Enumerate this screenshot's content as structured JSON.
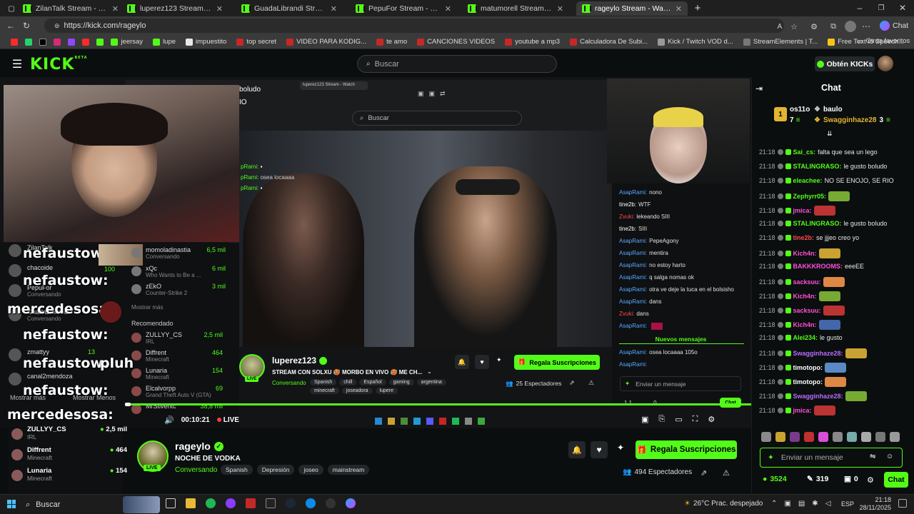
{
  "browser": {
    "tabs": [
      {
        "title": "ZilanTalk Stream - Watch Live"
      },
      {
        "title": "luperez123 Stream - Watch Live"
      },
      {
        "title": "GuadaLibrandi Stream - Watch Live"
      },
      {
        "title": "PepuFor Stream - Watch Live"
      },
      {
        "title": "matumorell Stream - Watch Live"
      },
      {
        "title": "rageylo Stream - Watch Live",
        "active": true
      }
    ],
    "url": "https://kick.com/rageylo",
    "profile_label": "Chat",
    "bookmarks": [
      {
        "label": "jeersay"
      },
      {
        "label": "lupe"
      },
      {
        "label": "impuestito"
      },
      {
        "label": "top secret"
      },
      {
        "label": "VIDEO PARA KODIG..."
      },
      {
        "label": "te amo"
      },
      {
        "label": "CANCIONES VIDEOS"
      },
      {
        "label": "youtube a mp3"
      },
      {
        "label": "Calculadora De Subi..."
      },
      {
        "label": "Kick / Twitch VOD d..."
      },
      {
        "label": "StreamElements | T..."
      },
      {
        "label": "Free Text to Speech..."
      }
    ],
    "other_bookmarks": "Otros favoritos"
  },
  "header": {
    "logo": "KICK",
    "logo_sup": "BETA",
    "search_placeholder": "Buscar",
    "get_kicks": "Obtén KICKs"
  },
  "inner_capture": {
    "search_placeholder": "Buscar",
    "tab_title": "luperez123 Stream - Watch",
    "partial_text_1": "boludo",
    "partial_text_2": "IO",
    "partial_text_3": "oludo",
    "chat_lines": [
      {
        "user": "AsapRami:",
        "text": "nono"
      },
      {
        "user": "tine2b:",
        "text": "WTF"
      },
      {
        "user": "Zvuki:",
        "text": "lekeando SIII"
      },
      {
        "user": "tine2b:",
        "text": "SIII"
      },
      {
        "user": "AsapRami:",
        "text": "PepeAgony"
      },
      {
        "user": "AsapRami:",
        "text": "mentira"
      },
      {
        "user": "AsapRami:",
        "text": "no estoy harto"
      },
      {
        "user": "AsapRami:",
        "text": "q salga nomas ok"
      },
      {
        "user": "AsapRami:",
        "text": "otra ve deje la tuca en el bolsisho"
      },
      {
        "user": "AsapRami:",
        "text": "dans"
      },
      {
        "user": "Zvuki:",
        "text": "dans"
      },
      {
        "user": "AsapRami:",
        "text": ""
      }
    ],
    "new_messages": "Nuevos mensajes",
    "chat_lines_after": [
      {
        "user": "AsapRami:",
        "text": "osea locaaaa 105o"
      },
      {
        "user": "AsapRami:",
        "text": ""
      }
    ],
    "chat_input_placeholder": "Enviar un mensaje",
    "chat_button": "Chat",
    "left_overlay": [
      {
        "user": "ZilanTalk"
      },
      {
        "user": "chacoide"
      },
      {
        "user": "PepuFor",
        "sub": "Conversando"
      },
      {
        "user": "GuadaLibrandi",
        "sub": "Conversando"
      },
      {
        "user": "zmattyy",
        "count": "13"
      },
      {
        "user": "canal2mendoza"
      }
    ],
    "overlay_words": [
      "nefaustow:",
      "nefaustow:",
      "mercedesosa:",
      "nefaustow:",
      "nefaustow:",
      "nefaustow:",
      "mercedesosa:"
    ],
    "pluh": "pluh",
    "count_100": "100",
    "show_more": "Mostrar más",
    "show_less": "Mostrar Menos",
    "side_channels": [
      {
        "name": "momoladinastia",
        "sub": "Conversando",
        "count": "6,5 mil"
      },
      {
        "name": "xQc",
        "sub": "Who Wants to Be a ...",
        "count": "6 mil"
      },
      {
        "name": "zEkO",
        "sub": "Counter-Strike 2",
        "count": "3 mil"
      }
    ],
    "side_more": "Mostrar más",
    "recommended": "Recomendado",
    "recommended_channels": [
      {
        "name": "ZULLYY_CS",
        "sub": "IRL",
        "count": "2,5 mil"
      },
      {
        "name": "Diffrent",
        "sub": "Minecraft",
        "count": "464"
      },
      {
        "name": "Lunaria",
        "sub": "Minecraft",
        "count": "154"
      },
      {
        "name": "Elcalvorpp",
        "sub": "Grand Theft Auto V (GTA)",
        "count": "69"
      },
      {
        "name": "MrStiventc",
        "sub": "",
        "count": "38,8 mil"
      }
    ],
    "stream": {
      "channel": "luperez123",
      "title": "STREAM CON SOLXU 🥵 MORBO EN VIVO 🥵 ME CH...",
      "category": "Conversando",
      "tags": [
        "Spanish",
        "chill",
        "Español",
        "gaming",
        "argentina",
        "minecraft",
        "joseadora",
        "lupere"
      ],
      "sub_button": "Regala Suscripciones",
      "viewers": "25 Espectadores",
      "live": "LIVE"
    },
    "bottom_counts": {
      "a": "1.1",
      "b": "0"
    }
  },
  "player": {
    "time": "00:10:21",
    "live": "LIVE"
  },
  "left_sidebar": [
    {
      "name": "ZULLYY_CS",
      "sub": "IRL",
      "count": "2,5 mil"
    },
    {
      "name": "Diffrent",
      "sub": "Minecraft",
      "count": "464"
    },
    {
      "name": "Lunaria",
      "sub": "Minecraft",
      "count": "154"
    }
  ],
  "stream_info": {
    "channel": "rageylo",
    "title": "NOCHE DE VODKA",
    "category": "Conversando",
    "tags": [
      "Spanish",
      "Depresión",
      "joseo",
      "mainstream"
    ],
    "live": "LIVE",
    "sub_button": "Regala Suscripciones",
    "viewers": "494 Espectadores"
  },
  "chat": {
    "title": "Chat",
    "pinned": [
      {
        "user": "os11o",
        "count": "7"
      },
      {
        "user": "baulo"
      },
      {
        "user": "Swagginhaze28",
        "count": "3"
      }
    ],
    "top_rank": "1",
    "messages": [
      {
        "time": "21:18",
        "user": "Sai_cs:",
        "text": "falta que sea un lego",
        "color": "#53fc18"
      },
      {
        "time": "21:18",
        "user": "STALINGRASO:",
        "text": "le gusto boludo",
        "color": "#53fc18"
      },
      {
        "time": "21:18",
        "user": "eleachee:",
        "text": "NO SE ENOJO, SE RIO",
        "color": "#53fc18"
      },
      {
        "time": "21:18",
        "user": "Zephyrr05:",
        "text": "",
        "color": "#53fc18"
      },
      {
        "time": "21:18",
        "user": "jmica:",
        "text": "",
        "color": "#ff4fd8"
      },
      {
        "time": "21:18",
        "user": "STALINGRASO:",
        "text": "le gusto boludo",
        "color": "#53fc18"
      },
      {
        "time": "21:18",
        "user": "tine2b:",
        "text": "se jjjeo creo yo",
        "color": "#ff4a4a"
      },
      {
        "time": "21:18",
        "user": "Kich4n:",
        "text": "",
        "color": "#ff4fd8"
      },
      {
        "time": "21:18",
        "user": "BAKKKROOMS:",
        "text": "eeeEE",
        "color": "#ff4fd8"
      },
      {
        "time": "21:18",
        "user": "sacksuu:",
        "text": "",
        "color": "#ff4fd8"
      },
      {
        "time": "21:18",
        "user": "Kich4n:",
        "text": "",
        "color": "#ff4fd8"
      },
      {
        "time": "21:18",
        "user": "sacksuu:",
        "text": "",
        "color": "#ff4fd8"
      },
      {
        "time": "21:18",
        "user": "Kich4n:",
        "text": "",
        "color": "#ff4fd8"
      },
      {
        "time": "21:18",
        "user": "Alei234:",
        "text": "le gusto",
        "color": "#53fc18"
      },
      {
        "time": "21:18",
        "user": "Swagginhaze28:",
        "text": "",
        "color": "#b86bff"
      },
      {
        "time": "21:18",
        "user": "timotopo:",
        "text": "",
        "color": "#ffffff"
      },
      {
        "time": "21:18",
        "user": "timotopo:",
        "text": "",
        "color": "#ffffff"
      },
      {
        "time": "21:18",
        "user": "Swagginhaze28:",
        "text": "",
        "color": "#b86bff"
      },
      {
        "time": "21:18",
        "user": "jmica:",
        "text": "",
        "color": "#ff4fd8"
      }
    ],
    "input_placeholder": "Enviar un mensaje",
    "kicks_count": "3524",
    "points_count": "319",
    "gifts_count": "0",
    "chat_button": "Chat"
  },
  "taskbar": {
    "search": "Buscar",
    "weather": "26°C  Prac. despejado",
    "lang": "ESP",
    "time": "21:18",
    "date": "28/11/2025"
  },
  "colors": {
    "kick_green": "#53fc18",
    "bg": "#0b0e0f"
  }
}
